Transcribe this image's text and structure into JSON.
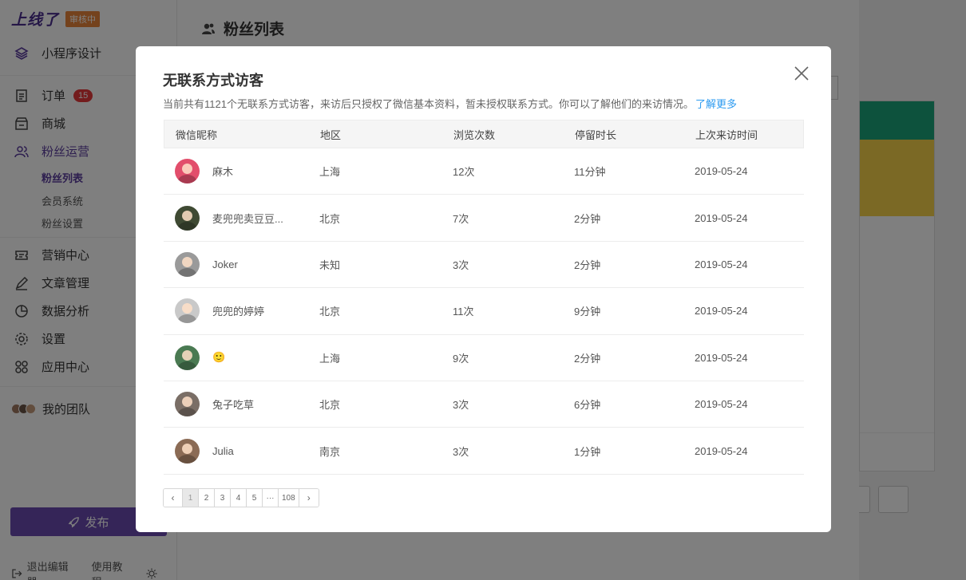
{
  "sidebar": {
    "logo": "上线了",
    "status_badge": "审核中",
    "mini_program_design": "小程序设计",
    "orders": "订单",
    "orders_badge": "15",
    "mall": "商城",
    "fans_ops": "粉丝运营",
    "sub_fans_list": "粉丝列表",
    "sub_member_system": "会员系统",
    "sub_fans_settings": "粉丝设置",
    "marketing": "营销中心",
    "articles": "文章管理",
    "analytics": "数据分析",
    "settings": "设置",
    "app_center": "应用中心",
    "my_team": "我的团队",
    "publish": "发布",
    "exit_editor": "退出编辑器",
    "tutorial": "使用教程"
  },
  "main": {
    "title": "粉丝列表"
  },
  "modal": {
    "title": "无联系方式访客",
    "description": "当前共有1121个无联系方式访客，来访后只授权了微信基本资料，暂未授权联系方式。你可以了解他们的来访情况。",
    "learn_more": "了解更多",
    "columns": [
      "微信昵称",
      "地区",
      "浏览次数",
      "停留时长",
      "上次来访时间"
    ],
    "rows": [
      {
        "nickname": "麻木",
        "region": "上海",
        "views": "12次",
        "duration": "11分钟",
        "last_visit": "2019-05-24",
        "avatar_color": "#e24e6b"
      },
      {
        "nickname": "麦兜兜卖豆豆...",
        "region": "北京",
        "views": "7次",
        "duration": "2分钟",
        "last_visit": "2019-05-24",
        "avatar_color": "#3f4a33"
      },
      {
        "nickname": "Joker",
        "region": "未知",
        "views": "3次",
        "duration": "2分钟",
        "last_visit": "2019-05-24",
        "avatar_color": "#9a9a9a"
      },
      {
        "nickname": "兜兜的婷婷",
        "region": "北京",
        "views": "11次",
        "duration": "9分钟",
        "last_visit": "2019-05-24",
        "avatar_color": "#c9c9c9"
      },
      {
        "nickname": "🙂",
        "region": "上海",
        "views": "9次",
        "duration": "2分钟",
        "last_visit": "2019-05-24",
        "avatar_color": "#4a7a52"
      },
      {
        "nickname": "兔子吃草",
        "region": "北京",
        "views": "3次",
        "duration": "6分钟",
        "last_visit": "2019-05-24",
        "avatar_color": "#7a6e66"
      },
      {
        "nickname": "Julia",
        "region": "南京",
        "views": "3次",
        "duration": "1分钟",
        "last_visit": "2019-05-24",
        "avatar_color": "#8b6b55"
      }
    ],
    "pagination": {
      "prev": "‹",
      "pages": [
        "1",
        "2",
        "3",
        "4",
        "5",
        "···",
        "108"
      ],
      "current": "1",
      "next": "›"
    }
  }
}
